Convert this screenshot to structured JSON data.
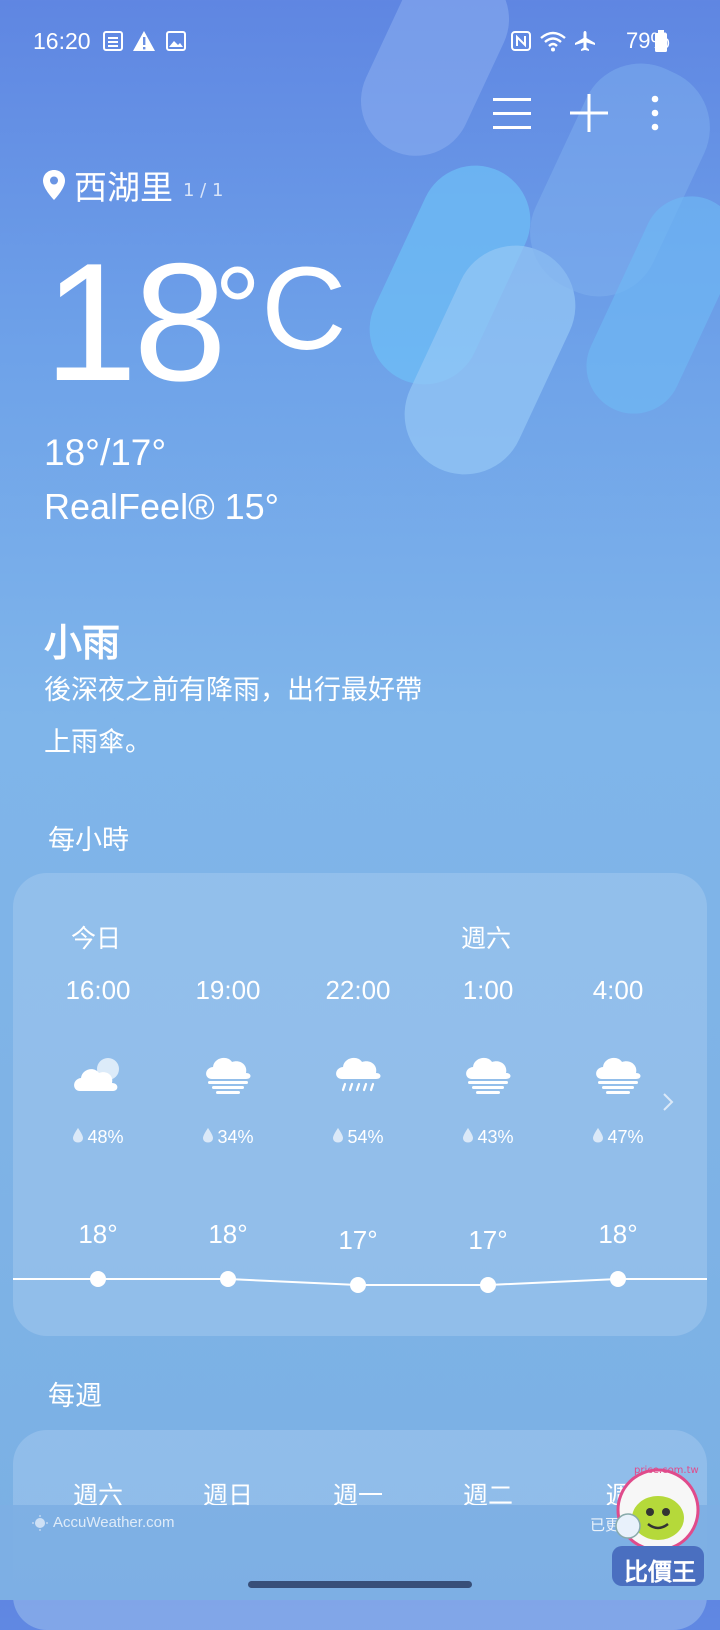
{
  "status_bar": {
    "time": "16:20",
    "battery": "79%",
    "left_icons": [
      "sim-card-icon",
      "warning-icon",
      "image-icon"
    ],
    "right_icons": [
      "nfc-icon",
      "wifi-icon",
      "airplane-icon",
      "battery-icon"
    ]
  },
  "toolbar": {
    "icons": [
      "menu-icon",
      "add-icon",
      "more-vert-icon"
    ]
  },
  "location": {
    "name": "西湖里",
    "page": "1 / 1"
  },
  "current": {
    "temp": "18",
    "unit": "°C",
    "hi_lo": "18°/17°",
    "realfeel": "RealFeel® 15°",
    "condition": "小雨",
    "description_line1": "後深夜之前有降雨，出行最好帶",
    "description_line2": "上雨傘。"
  },
  "hourly": {
    "title": "每小時",
    "day_today": "今日",
    "day_next": "週六",
    "items": [
      {
        "time": "16:00",
        "icon": "partly-cloudy-icon",
        "precip": "48%",
        "temp": "18°",
        "temp_value": 18
      },
      {
        "time": "19:00",
        "icon": "fog-cloud-icon",
        "precip": "34%",
        "temp": "18°",
        "temp_value": 18
      },
      {
        "time": "22:00",
        "icon": "rain-cloud-icon",
        "precip": "54%",
        "temp": "17°",
        "temp_value": 17
      },
      {
        "time": "1:00",
        "icon": "fog-cloud-icon",
        "precip": "43%",
        "temp": "17°",
        "temp_value": 17
      },
      {
        "time": "4:00",
        "icon": "fog-cloud-icon",
        "precip": "47%",
        "temp": "18°",
        "temp_value": 18
      }
    ]
  },
  "weekly": {
    "title": "每週",
    "days": [
      "週六",
      "週日",
      "週一",
      "週二",
      "週"
    ]
  },
  "footer": {
    "provider": "AccuWeather.com",
    "updated": "已更新 15:58"
  },
  "watermark": {
    "text": "比價王",
    "site": "price.com.tw"
  }
}
